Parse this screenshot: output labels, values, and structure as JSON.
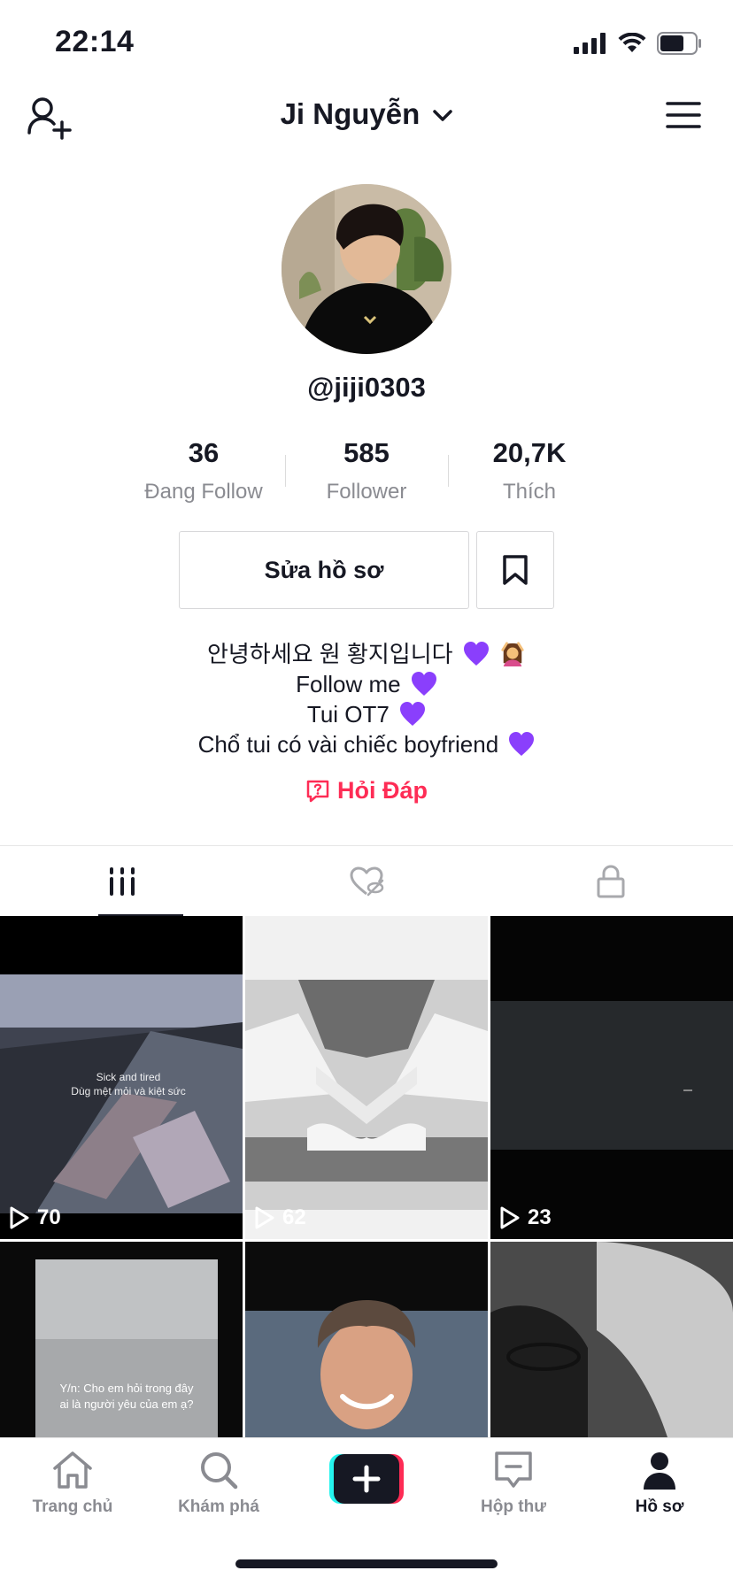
{
  "status": {
    "time": "22:14"
  },
  "header": {
    "title": "Ji Nguyễn"
  },
  "profile": {
    "handle": "@jiji0303",
    "stats": [
      {
        "value": "36",
        "label": "Đang Follow"
      },
      {
        "value": "585",
        "label": "Follower"
      },
      {
        "value": "20,7K",
        "label": "Thích"
      }
    ],
    "edit_label": "Sửa hồ sơ",
    "bio": [
      "안녕하세요 원 황지입니다",
      "Follow me",
      "Tui OT7",
      "Chổ tui có vài chiếc boyfriend"
    ],
    "qa_label": "Hỏi Đáp"
  },
  "grid": {
    "videos": [
      {
        "plays": "70",
        "overlay_text": [
          "Sick and tired",
          "Dùg mệt mỏi và kiệt sức"
        ]
      },
      {
        "plays": "62",
        "overlay_text": []
      },
      {
        "plays": "23",
        "overlay_text": []
      },
      {
        "plays": "",
        "overlay_text": [
          "Y/n: Cho em hỏi trong đây",
          "ai là người yêu của em ạ?"
        ]
      },
      {
        "plays": "",
        "overlay_text": []
      },
      {
        "plays": "",
        "overlay_text": []
      }
    ]
  },
  "nav": {
    "items": [
      {
        "label": "Trang chủ",
        "icon": "home-icon"
      },
      {
        "label": "Khám phá",
        "icon": "search-icon"
      },
      {
        "label": "",
        "icon": "plus-icon"
      },
      {
        "label": "Hộp thư",
        "icon": "inbox-icon"
      },
      {
        "label": "Hồ sơ",
        "icon": "profile-icon"
      }
    ]
  },
  "colors": {
    "accent": "#fe2c55",
    "heart": "#8a3ffc",
    "text": "#161823",
    "muted": "#8a8b91"
  }
}
